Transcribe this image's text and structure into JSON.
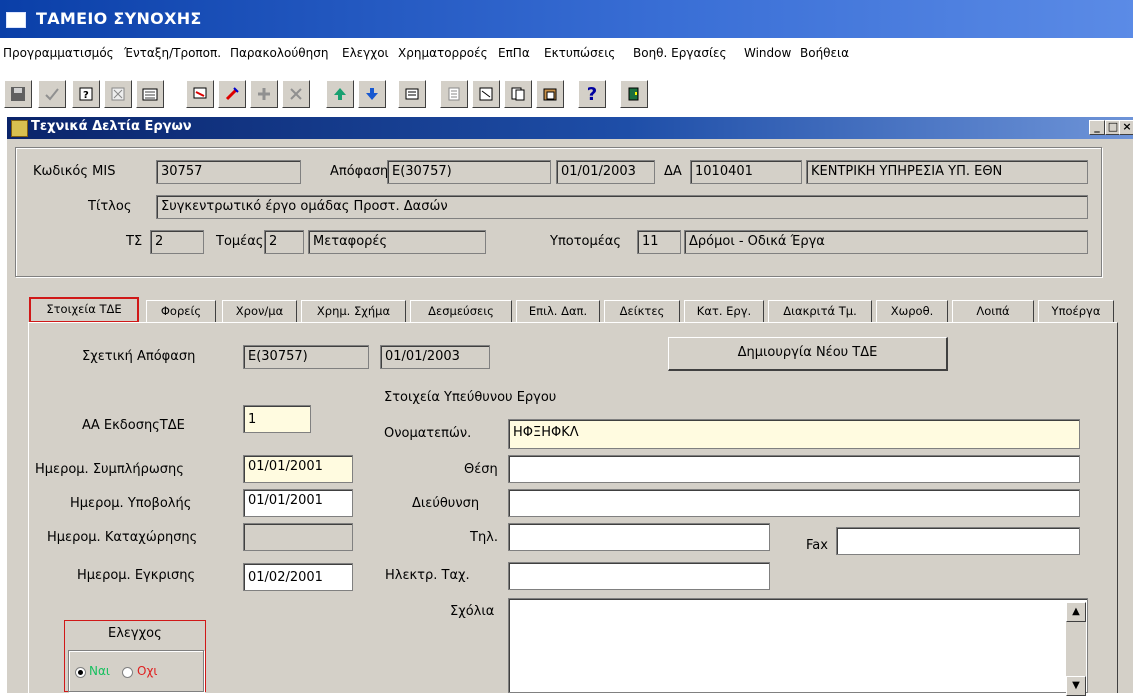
{
  "app": {
    "title": "ΤΑΜΕΙΟ ΣΥΝΟΧΗΣ"
  },
  "menu": [
    "Προγραμματισμός",
    "Ένταξη/Τροποπ.",
    "Παρακολούθηση",
    "Ελεγχοι",
    "Χρηματορροές",
    "ΕπΠα",
    "Εκτυπώσεις",
    "Βοηθ. Εργασίες",
    "Window",
    "Βοήθεια"
  ],
  "toolbar": {
    "icons": [
      "save-icon",
      "check-icon",
      "query-icon",
      "cancel-query-icon",
      "execute-query-icon",
      "print-icon",
      "edit-icon",
      "insert-record-icon",
      "delete-record-icon",
      "previous-record-icon",
      "next-record-icon",
      "keyboard-icon",
      "list-icon",
      "notes-icon",
      "copy-icon",
      "paste-icon",
      "help-icon",
      "exit-icon"
    ],
    "glyphs": {
      "help": "?"
    }
  },
  "window": {
    "title": "Τεχνικά Δελτία Εργων",
    "controls": {
      "minimize": "_",
      "maximize": "□",
      "close": "×"
    }
  },
  "header": {
    "mis_label": "Κωδικός MIS",
    "mis_value": "30757",
    "decision_label": "Απόφαση",
    "decision_value": "Ε(30757)",
    "decision_date": "01/01/2003",
    "da_label": "ΔΑ",
    "da_value": "1010401",
    "agency_value": "ΚΕΝΤΡΙΚΗ ΥΠΗΡΕΣΙΑ ΥΠ. ΕΘΝ",
    "title_label": "Τίτλος",
    "title_value": "Συγκεντρωτικό έργο ομάδας Προστ. Δασών",
    "ts_label": "ΤΣ",
    "ts_value": "2",
    "sector_label": "Τομέας",
    "sector_code": "2",
    "sector_name": "Μεταφορές",
    "subsector_label": "Υποτομέας",
    "subsector_code": "11",
    "subsector_name": "Δρόμοι - Οδικά Έργα"
  },
  "tabs": [
    "Στοιχεία ΤΔΕ",
    "Φορείς",
    "Χρον/μα",
    "Χρημ. Σχήμα",
    "Δεσμεύσεις",
    "Επιλ. Δαπ.",
    "Δείκτες",
    "Κατ. Εργ.",
    "Διακριτά Τμ.",
    "Χωροθ.",
    "Λοιπά",
    "Υποέργα"
  ],
  "form": {
    "related_decision_label": "Σχετική Απόφαση",
    "related_decision_value": "Ε(30757)",
    "related_decision_date": "01/01/2003",
    "new_tde_button": "Δημιουργία Νέου ΤΔΕ",
    "responsible_header": "Στοιχεία Υπεύθυνου Εργου",
    "aa_label": "ΑΑ ΕκδοσηςΤΔΕ",
    "aa_value": "1",
    "name_label": "Ονοματεπών.",
    "name_value": "ΗΦΞΗΦΚΛ",
    "completion_label": "Ημερομ. Συμπλήρωσης",
    "completion_value": "01/01/2001",
    "position_label": "Θέση",
    "position_value": "",
    "submission_label": "Ημερομ. Υποβολής",
    "submission_value": "01/01/2001",
    "address_label": "Διεύθυνση",
    "address_value": "",
    "registration_label": "Ημερομ. Καταχώρησης",
    "registration_value": "",
    "phone_label": "Τηλ.",
    "phone_value": "",
    "fax_label": "Fax",
    "fax_value": "",
    "approval_label": "Ημερομ. Εγκρισης",
    "approval_value": "01/02/2001",
    "email_label": "Ηλεκτρ. Ταχ.",
    "email_value": "",
    "comments_label": "Σχόλια",
    "comments_value": "",
    "control_label": "Ελεγχος",
    "yes_label": "Ναι",
    "no_label": "Οχι"
  },
  "colors": {
    "yes": "#18c060",
    "no": "#e02020",
    "highlight": "#d01818"
  }
}
